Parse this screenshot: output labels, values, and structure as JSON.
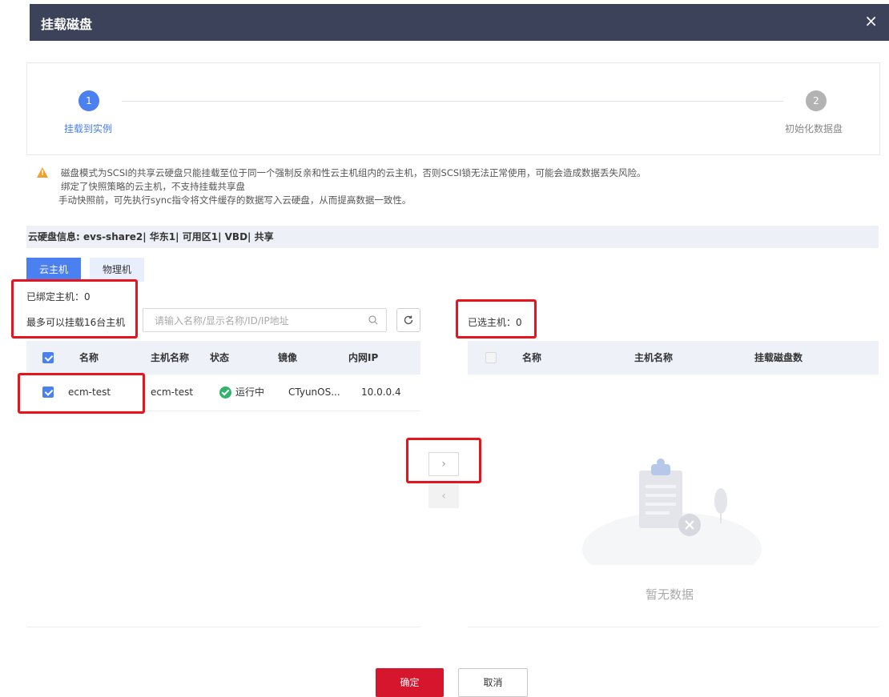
{
  "dialog": {
    "title": "挂载磁盘",
    "close_icon": "×"
  },
  "steps": [
    {
      "number": "1",
      "label": "挂载到实例",
      "state": "active",
      "color": "#4a80f0"
    },
    {
      "number": "2",
      "label": "初始化数据盘",
      "state": "pending",
      "color": "#aaaaaa"
    }
  ],
  "warning": {
    "icon": "warning-triangle-icon",
    "lines": [
      "磁盘模式为SCSI的共享云硬盘只能挂载至位于同一个强制反亲和性云主机组内的云主机，否则SCSI锁无法正常使用，可能会造成数据丢失风险。",
      "绑定了快照策略的云主机，不支持挂载共享盘",
      "手动快照前，可先执行sync指令将文件缓存的数据写入云硬盘，从而提高数据一致性。"
    ]
  },
  "disk_info": "云硬盘信息: evs-share2| 华东1| 可用区1| VBD| 共享",
  "tabs": [
    {
      "label": "云主机",
      "active": true
    },
    {
      "label": "物理机",
      "active": false
    }
  ],
  "left": {
    "bound_label": "已绑定主机：0",
    "max_label": "最多可以挂载16台主机",
    "search_placeholder": "请输入名称/显示名称/ID/IP地址",
    "search_icon": "magnifier-icon",
    "refresh_icon": "refresh-icon",
    "columns": [
      "名称",
      "主机名称",
      "状态",
      "镜像",
      "内网IP"
    ],
    "rows": [
      {
        "checked": true,
        "name": "ecm-test",
        "hostname": "ecm-test",
        "status": "运行中",
        "status_color": "#33b36b",
        "image": "CTyunOS...",
        "ip": "10.0.0.4"
      }
    ]
  },
  "right": {
    "selected_label": "已选主机：0",
    "columns": [
      "名称",
      "主机名称",
      "挂载磁盘数"
    ],
    "empty_text": "暂无数据"
  },
  "transfer": {
    "right_arrow": "›",
    "left_arrow": "‹"
  },
  "footer": {
    "ok_label": "确定",
    "cancel_label": "取消"
  },
  "colors": {
    "accent": "#4a80f0",
    "header": "#3b4259",
    "confirm": "#d6162c",
    "annotation": "#e8141d"
  }
}
